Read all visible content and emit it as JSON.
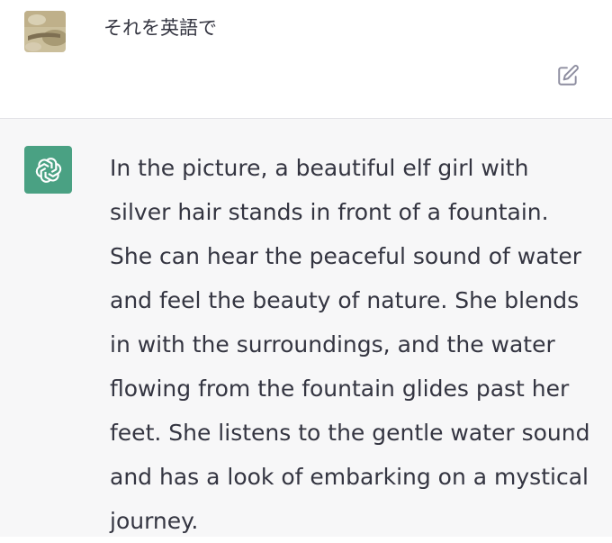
{
  "user_message": {
    "avatar_icon": "user-photo-avatar",
    "text": "それを英語で",
    "edit_icon": "edit-icon"
  },
  "assistant_message": {
    "avatar_icon": "openai-logo-icon",
    "avatar_color": "#4aa183",
    "text": "In the picture, a beautiful elf girl with silver hair stands in front of a fountain. She can hear the peaceful sound of water and feel the beauty of nature. She blends in with the surroundings, and the water flowing from the fountain glides past her feet. She listens to the gentle water sound and has a look of embarking on a mystical journey."
  },
  "colors": {
    "text": "#343541",
    "assistant_background": "#f7f7f8",
    "user_background": "#ffffff",
    "divider": "#e2e2e6"
  }
}
